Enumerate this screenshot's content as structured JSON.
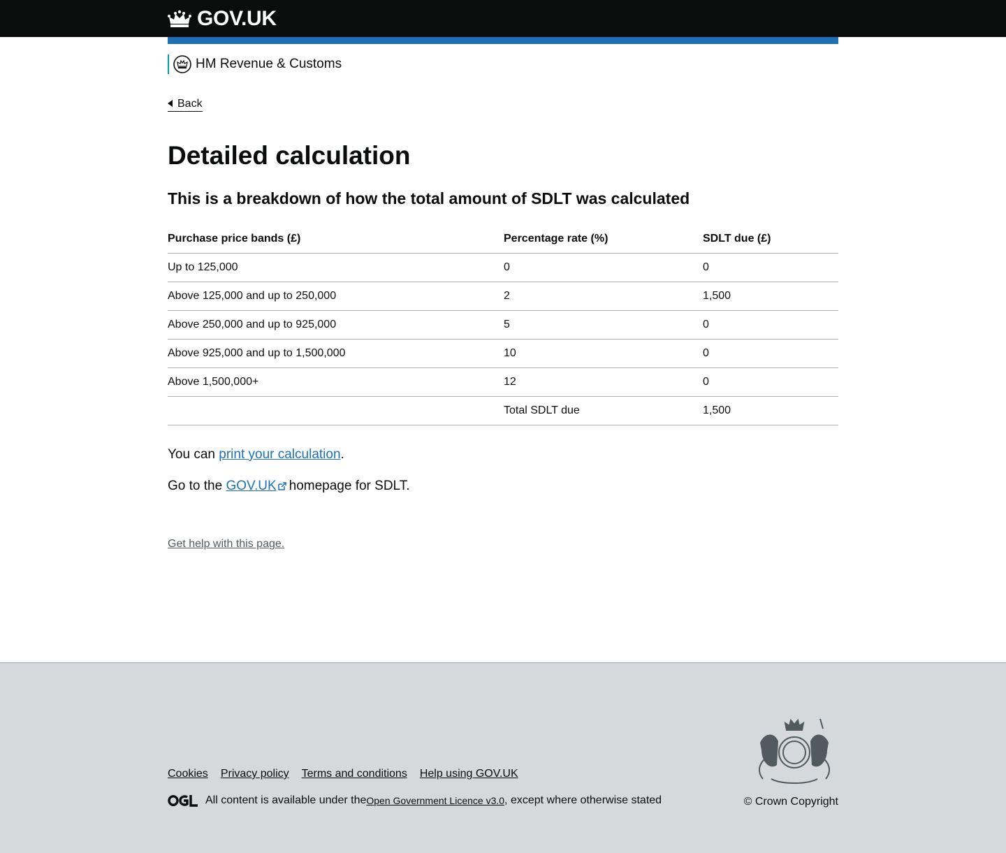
{
  "header": {
    "logo_text": "GOV.UK"
  },
  "organisation": {
    "name": "HM Revenue & Customs"
  },
  "back_link": "Back",
  "page": {
    "title": "Detailed calculation",
    "subtitle": "This is a breakdown of how the total amount of SDLT was calculated"
  },
  "table": {
    "headers": [
      "Purchase price bands (£)",
      "Percentage rate (%)",
      "SDLT due (£)"
    ],
    "rows": [
      [
        "Up to 125,000",
        "0",
        "0"
      ],
      [
        "Above 125,000 and up to 250,000",
        "2",
        "1,500"
      ],
      [
        "Above 250,000 and up to 925,000",
        "5",
        "0"
      ],
      [
        "Above 925,000 and up to 1,500,000",
        "10",
        "0"
      ],
      [
        "Above 1,500,000+",
        "12",
        "0"
      ]
    ],
    "total_label": "Total SDLT due",
    "total_value": "1,500"
  },
  "print_para": {
    "prefix": "You can ",
    "link": "print your calculation",
    "suffix": "."
  },
  "gov_para": {
    "prefix": "Go to the ",
    "link": "GOV.UK",
    "suffix": "homepage for SDLT."
  },
  "help_link": "Get help with this page.",
  "footer": {
    "links": [
      "Cookies",
      "Privacy policy",
      "Terms and conditions",
      "Help using GOV.UK"
    ],
    "licence_prefix": "All content is available under the ",
    "licence_link": "Open Government Licence v3.0",
    "licence_suffix": ", except where otherwise stated",
    "copyright": "© Crown Copyright"
  },
  "colors": {
    "header_bg": "#0b0c0c",
    "brand_blue": "#1d70b8",
    "hmrc_green": "#00a19c",
    "footer_bg": "#d5d9dc"
  }
}
